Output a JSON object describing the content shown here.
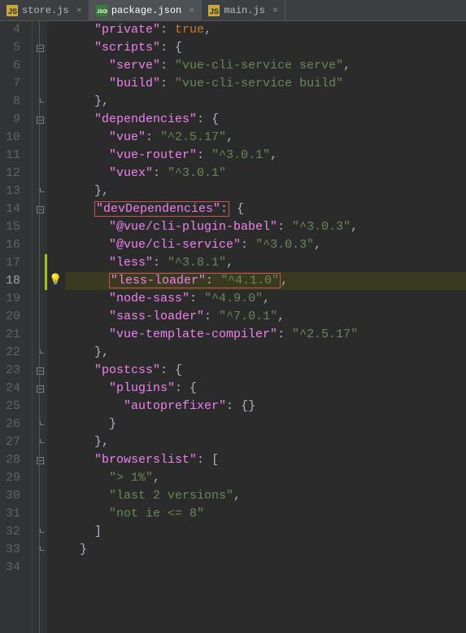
{
  "tabs": [
    {
      "label": "store.js",
      "icon": "js-file-icon",
      "active": false
    },
    {
      "label": "package.json",
      "icon": "json-file-icon",
      "active": true
    },
    {
      "label": "main.js",
      "icon": "js-file-icon",
      "active": false
    }
  ],
  "lines": {
    "start": 4,
    "end": 34,
    "current": 18
  },
  "code": {
    "l4": {
      "indent": "    ",
      "key": "\"private\"",
      "sep": ": ",
      "val": "true",
      "tail": ",",
      "valType": "bool"
    },
    "l5": {
      "indent": "    ",
      "key": "\"scripts\"",
      "sep": ": ",
      "brace": "{"
    },
    "l6": {
      "indent": "      ",
      "key": "\"serve\"",
      "sep": ": ",
      "val": "\"vue-cli-service serve\"",
      "tail": ","
    },
    "l7": {
      "indent": "      ",
      "key": "\"build\"",
      "sep": ": ",
      "val": "\"vue-cli-service build\"",
      "tail": ""
    },
    "l8": {
      "indent": "    ",
      "brace": "},",
      "close": true
    },
    "l9": {
      "indent": "    ",
      "key": "\"dependencies\"",
      "sep": ": ",
      "brace": "{"
    },
    "l10": {
      "indent": "      ",
      "key": "\"vue\"",
      "sep": ": ",
      "val": "\"^2.5.17\"",
      "tail": ","
    },
    "l11": {
      "indent": "      ",
      "key": "\"vue-router\"",
      "sep": ": ",
      "val": "\"^3.0.1\"",
      "tail": ","
    },
    "l12": {
      "indent": "      ",
      "key": "\"vuex\"",
      "sep": ": ",
      "val": "\"^3.0.1\"",
      "tail": ""
    },
    "l13": {
      "indent": "    ",
      "brace": "},",
      "close": true
    },
    "l14": {
      "indent": "    ",
      "key": "\"devDependencies\"",
      "sep": ": ",
      "brace": "{",
      "redBoxKey": true
    },
    "l15": {
      "indent": "      ",
      "key": "\"@vue/cli-plugin-babel\"",
      "sep": ": ",
      "val": "\"^3.0.3\"",
      "tail": ","
    },
    "l16": {
      "indent": "      ",
      "key": "\"@vue/cli-service\"",
      "sep": ": ",
      "val": "\"^3.0.3\"",
      "tail": ","
    },
    "l17": {
      "indent": "      ",
      "key": "\"less\"",
      "sep": ": ",
      "val": "\"^3.8.1\"",
      "tail": ",",
      "changed": true
    },
    "l18": {
      "indent": "      ",
      "key": "\"less-loader\"",
      "sep": ": ",
      "val": "\"^4.1.0\"",
      "tail": ",",
      "redBoxKV": true,
      "changed": true
    },
    "l19": {
      "indent": "      ",
      "key": "\"node-sass\"",
      "sep": ": ",
      "val": "\"^4.9.0\"",
      "tail": ","
    },
    "l20": {
      "indent": "      ",
      "key": "\"sass-loader\"",
      "sep": ": ",
      "val": "\"^7.0.1\"",
      "tail": ","
    },
    "l21": {
      "indent": "      ",
      "key": "\"vue-template-compiler\"",
      "sep": ": ",
      "val": "\"^2.5.17\"",
      "tail": ""
    },
    "l22": {
      "indent": "    ",
      "brace": "},",
      "close": true
    },
    "l23": {
      "indent": "    ",
      "key": "\"postcss\"",
      "sep": ": ",
      "brace": "{"
    },
    "l24": {
      "indent": "      ",
      "key": "\"plugins\"",
      "sep": ": ",
      "brace": "{"
    },
    "l25": {
      "indent": "        ",
      "key": "\"autoprefixer\"",
      "sep": ": ",
      "val": "{}",
      "tail": "",
      "valType": "punc"
    },
    "l26": {
      "indent": "      ",
      "brace": "}",
      "close": true
    },
    "l27": {
      "indent": "    ",
      "brace": "},",
      "close": true
    },
    "l28": {
      "indent": "    ",
      "key": "\"browserslist\"",
      "sep": ": ",
      "brace": "["
    },
    "l29": {
      "indent": "      ",
      "val": "\"> 1%\"",
      "tail": ","
    },
    "l30": {
      "indent": "      ",
      "val": "\"last 2 versions\"",
      "tail": ","
    },
    "l31": {
      "indent": "      ",
      "val": "\"not ie <= 8\"",
      "tail": ""
    },
    "l32": {
      "indent": "    ",
      "brace": "]",
      "close": true
    },
    "l33": {
      "indent": "  ",
      "brace": "}",
      "close": true
    },
    "l34": {
      "indent": "",
      "brace": "",
      "close": false
    }
  },
  "foldMarks": {
    "5": "open",
    "8": "close",
    "9": "open",
    "13": "close",
    "14": "open",
    "22": "close",
    "23": "open",
    "27": "close",
    "24": "open",
    "26": "close",
    "28": "open",
    "32": "close",
    "33": "close"
  }
}
